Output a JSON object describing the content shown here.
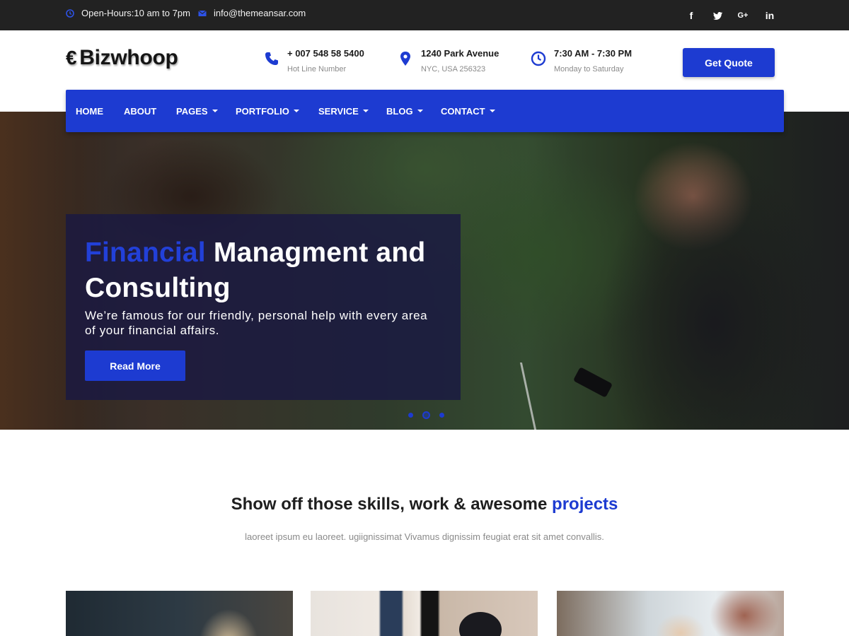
{
  "topbar": {
    "hours": "Open-Hours:10 am to 7pm",
    "email": "info@themeansar.com",
    "social": [
      {
        "icon": "facebook-icon",
        "glyph": "f"
      },
      {
        "icon": "twitter-icon",
        "glyph": "🐦"
      },
      {
        "icon": "google-plus-icon",
        "glyph": "G+"
      },
      {
        "icon": "linkedin-icon",
        "glyph": "in"
      }
    ]
  },
  "header": {
    "logo_symbol": "€",
    "logo_text": "Bizwhoop",
    "phone": {
      "value": "+ 007 548 58 5400",
      "label": "Hot Line Number"
    },
    "address": {
      "value": "1240 Park Avenue",
      "label": "NYC, USA 256323"
    },
    "hours": {
      "value": "7:30 AM - 7:30 PM",
      "label": "Monday to Saturday"
    },
    "cta": "Get Quote"
  },
  "nav": {
    "items": [
      {
        "label": "HOME"
      },
      {
        "label": "ABOUT"
      },
      {
        "label": "PAGES"
      },
      {
        "label": "PORTFOLIO"
      },
      {
        "label": "SERVICE"
      },
      {
        "label": "BLOG"
      },
      {
        "label": "CONTACT"
      }
    ]
  },
  "hero": {
    "title_accent": "Financial",
    "title_rest": "Managment and Consulting",
    "text": "We’re famous for our friendly, personal help with every area of your financial affairs.",
    "button": "Read More",
    "slides": 3,
    "active_slide": 2
  },
  "section": {
    "title_main": "Show off those skills, work & awesome",
    "title_accent": "projects",
    "subtitle": "laoreet ipsum eu laoreet. ugiignissimat Vivamus dignissim feugiat erat sit amet convallis."
  },
  "colors": {
    "accent": "#1d3bd1",
    "topbar": "#222222",
    "hero_overlay": "#1a1842"
  }
}
